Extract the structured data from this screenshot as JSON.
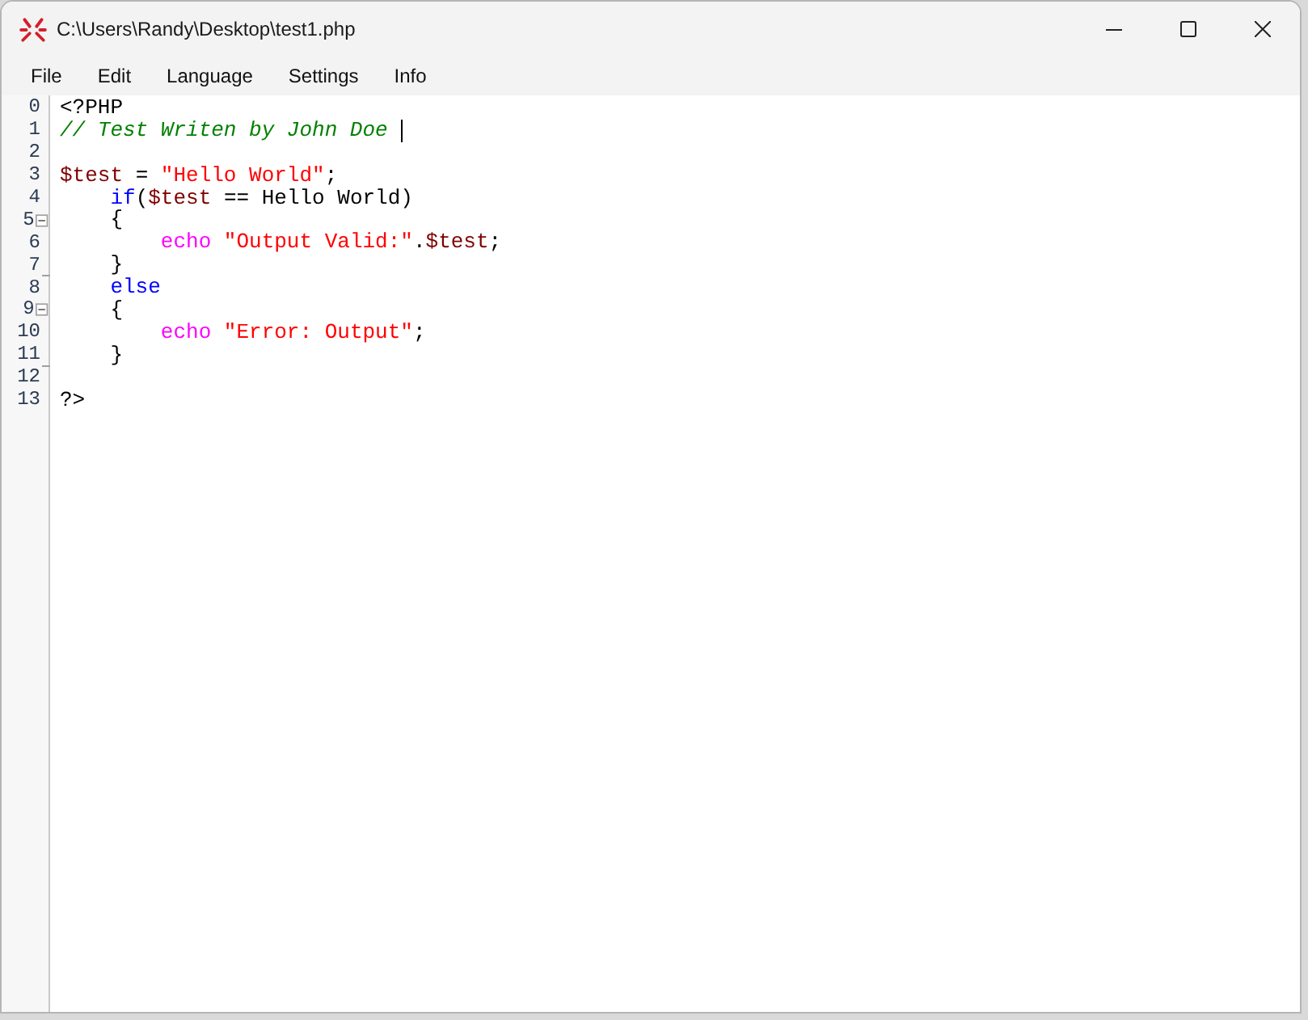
{
  "window": {
    "title": "C:\\Users\\Randy\\Desktop\\test1.php"
  },
  "menu": [
    "File",
    "Edit",
    "Language",
    "Settings",
    "Info"
  ],
  "editor": {
    "lines": [
      {
        "number": "0",
        "tokens": [
          {
            "kind": "plain",
            "text": "<?PHP"
          }
        ]
      },
      {
        "number": "1",
        "cursor": true,
        "tokens": [
          {
            "kind": "comment",
            "text": "// Test Writen by John Doe "
          }
        ]
      },
      {
        "number": "2"
      },
      {
        "number": "3",
        "tokens": [
          {
            "kind": "variable",
            "text": "$test"
          },
          {
            "kind": "plain",
            "text": " = "
          },
          {
            "kind": "string",
            "text": "\"Hello World\""
          },
          {
            "kind": "plain",
            "text": ";"
          }
        ]
      },
      {
        "number": "4",
        "tokens": [
          {
            "kind": "keyword",
            "text": "    if"
          },
          {
            "kind": "plain",
            "text": "("
          },
          {
            "kind": "variable",
            "text": "$test"
          },
          {
            "kind": "plain",
            "text": " == Hello World)"
          }
        ]
      },
      {
        "number": "5",
        "fold_start": true,
        "tokens": [
          {
            "kind": "plain",
            "text": "    {"
          }
        ]
      },
      {
        "number": "6",
        "tokens": [
          {
            "kind": "function",
            "text": "        echo"
          },
          {
            "kind": "string",
            "text": " \"Output Valid:\""
          },
          {
            "kind": "plain",
            "text": "."
          },
          {
            "kind": "variable",
            "text": "$test"
          },
          {
            "kind": "plain",
            "text": ";"
          }
        ]
      },
      {
        "number": "7",
        "fold_end": true,
        "tokens": [
          {
            "kind": "plain",
            "text": "    }"
          }
        ]
      },
      {
        "number": "8",
        "tokens": [
          {
            "kind": "keyword",
            "text": "    else"
          }
        ]
      },
      {
        "number": "9",
        "fold_start": true,
        "tokens": [
          {
            "kind": "plain",
            "text": "    {"
          }
        ]
      },
      {
        "number": "10",
        "tokens": [
          {
            "kind": "function",
            "text": "        echo"
          },
          {
            "kind": "string",
            "text": " \"Error: Output\""
          },
          {
            "kind": "plain",
            "text": ";"
          }
        ]
      },
      {
        "number": "11",
        "fold_end": true,
        "tokens": [
          {
            "kind": "plain",
            "text": "    }"
          }
        ]
      },
      {
        "number": "12"
      },
      {
        "number": "13",
        "tokens": [
          {
            "kind": "plain",
            "text": "?>"
          }
        ]
      }
    ]
  }
}
